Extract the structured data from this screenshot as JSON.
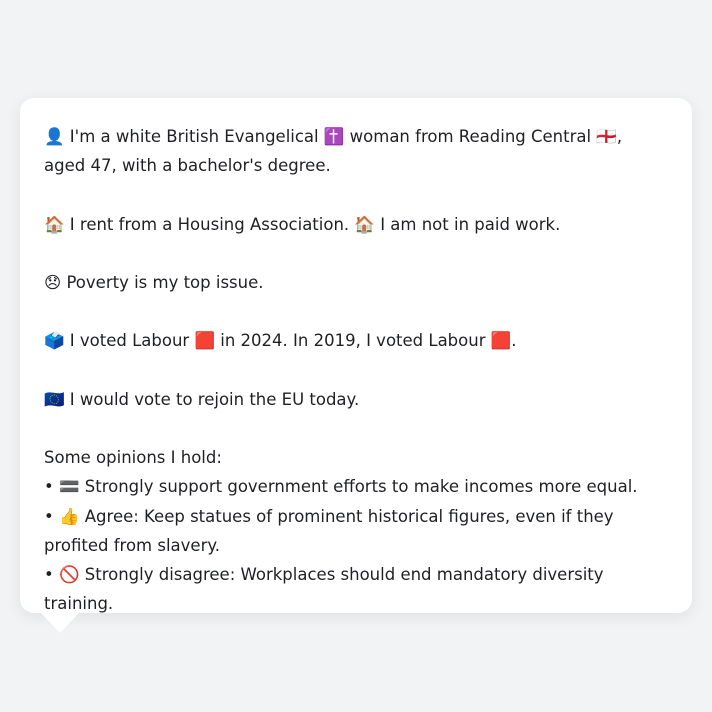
{
  "profile": {
    "identity": "👤 I'm a white British Evangelical ✝️ woman from Reading Central 🏴󠁧󠁢󠁥󠁮󠁧󠁿, aged 47, with a bachelor's degree.",
    "housing": "🏠 I rent from a Housing Association. 🏠 I am not in paid work.",
    "top_issue": "😞 Poverty is my top issue.",
    "voting": "🗳️ I voted Labour 🟥 in 2024. In 2019, I voted Labour 🟥.",
    "eu": "🇪🇺 I would vote to rejoin the EU today.",
    "opinions_heading": "Some opinions I hold:",
    "opinions": [
      "• 🟰 Strongly support government efforts to make incomes more equal.",
      "• 👍 Agree: Keep statues of prominent historical figures, even if they profited from slavery.",
      "• 🚫 Strongly disagree: Workplaces should end mandatory diversity training."
    ]
  }
}
